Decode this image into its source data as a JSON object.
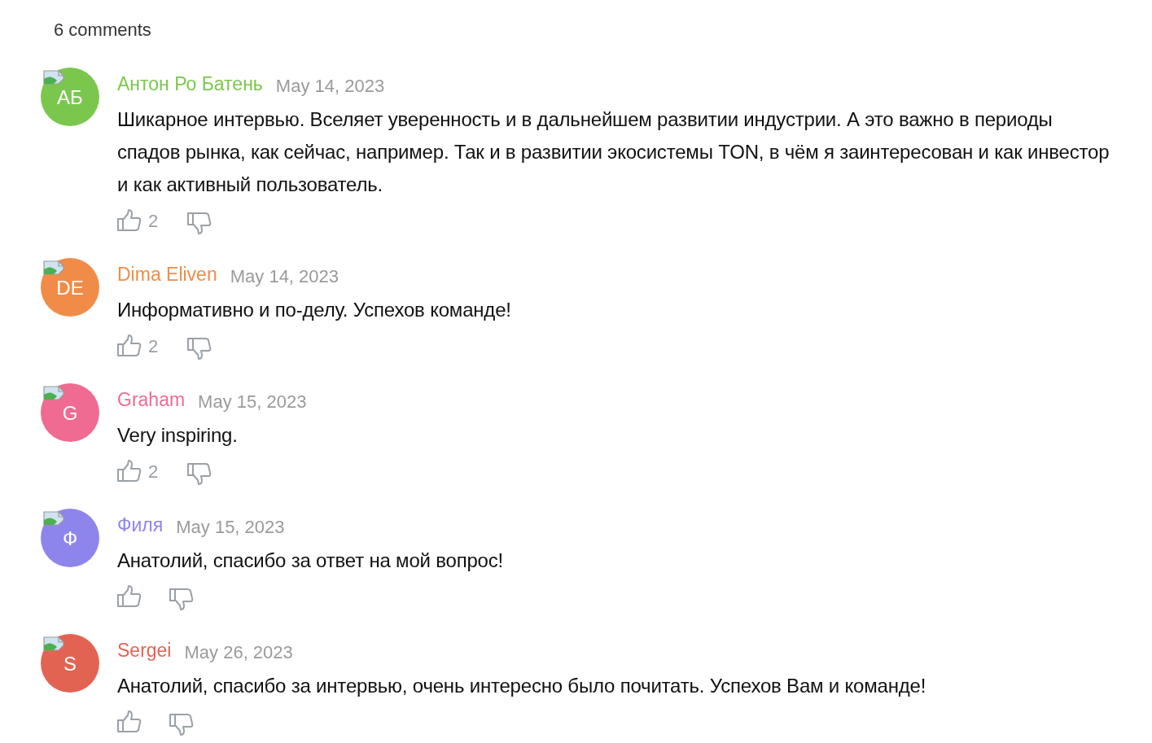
{
  "header": {
    "title": "6 comments"
  },
  "comments": [
    {
      "initials": "АБ",
      "author": "Антон Ро Батень",
      "date": "May 14, 2023",
      "color": "#7bc74d",
      "text": "Шикарное интервью. Вселяет уверенность и в дальнейшем развитии индустрии. А это важно в периоды спадов рынка, как сейчас, например. Так и в развитии экосистемы TON, в чём я заинтересован и как инвестор и как активный пользователь.",
      "likes": "2"
    },
    {
      "initials": "DE",
      "author": "Dima Eliven",
      "date": "May 14, 2023",
      "color": "#f08c47",
      "text": "Информативно и по-делу. Успехов команде!",
      "likes": "2"
    },
    {
      "initials": "G",
      "author": "Graham",
      "date": "May 15, 2023",
      "color": "#ef6b92",
      "text": "Very inspiring.",
      "likes": "2"
    },
    {
      "initials": "Ф",
      "author": "Филя",
      "date": "May 15, 2023",
      "color": "#8e85ec",
      "text": "Анатолий, спасибо за ответ на мой вопрос!"
    },
    {
      "initials": "S",
      "author": "Sergei",
      "date": "May 26, 2023",
      "color": "#e36352",
      "text": "Анатолий, спасибо за интервью, очень интересно было почитать. Успехов Вам и команде!"
    }
  ]
}
